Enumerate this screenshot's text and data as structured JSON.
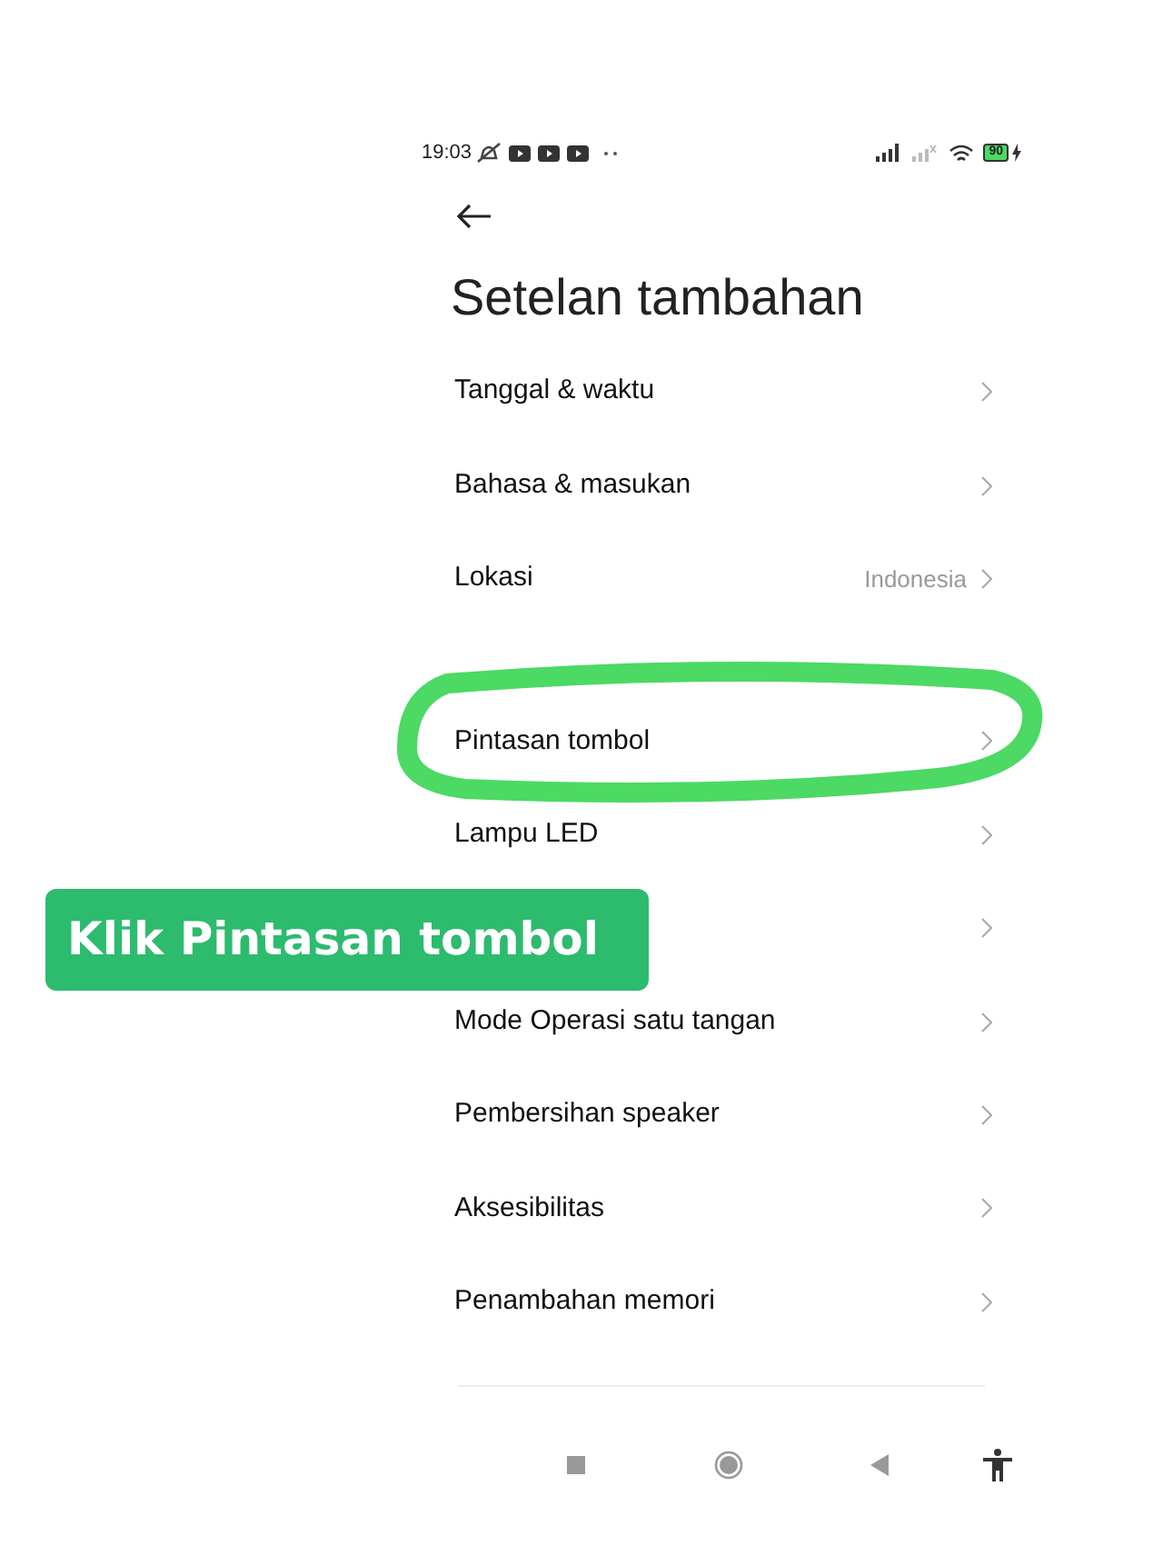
{
  "status_bar": {
    "time": "19:03",
    "battery": "90"
  },
  "title": "Setelan tambahan",
  "groups": [
    {
      "items": [
        {
          "label": "Tanggal & waktu",
          "highlighted": false
        },
        {
          "label": "Bahasa & masukan",
          "highlighted": false
        },
        {
          "label": "Lokasi",
          "value": "Indonesia",
          "highlighted": false
        }
      ]
    },
    {
      "items": [
        {
          "label": "Pintasan tombol",
          "highlighted": true
        },
        {
          "label": "Lampu LED",
          "highlighted": false
        },
        {
          "highlighted": false
        },
        {
          "label": "Mode Operasi satu tangan",
          "highlighted": false
        },
        {
          "label": "Pembersihan speaker",
          "highlighted": false
        },
        {
          "label": "Aksesibilitas",
          "highlighted": false
        },
        {
          "label": "Penambahan memori",
          "highlighted": false
        }
      ]
    }
  ],
  "callout": {
    "text": "Klik Pintasan tombol"
  }
}
